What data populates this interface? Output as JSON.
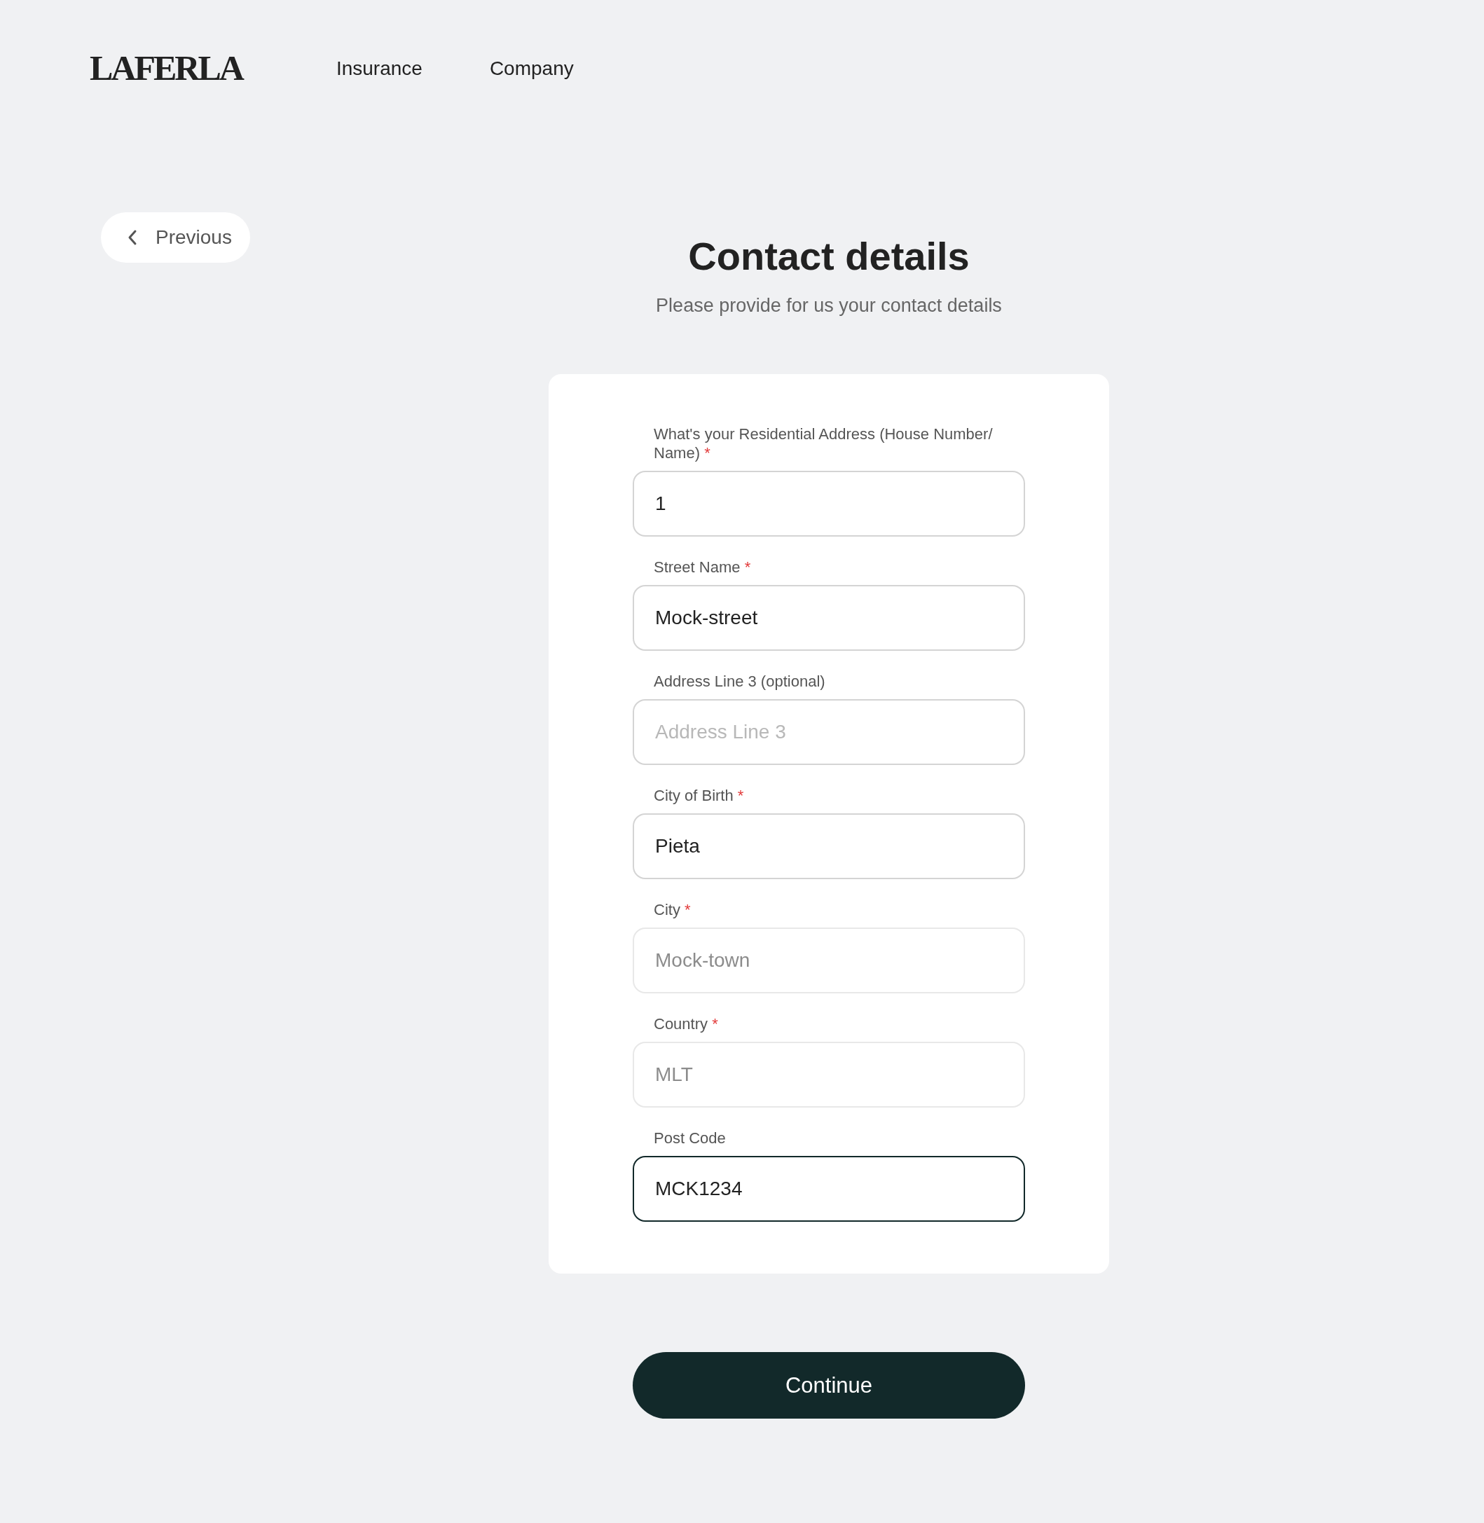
{
  "header": {
    "logo": "LAFERLA",
    "nav": [
      "Insurance",
      "Company"
    ]
  },
  "back_button": {
    "label": "Previous"
  },
  "title": "Contact details",
  "subtitle": "Please provide for us your contact details",
  "form": {
    "fields": [
      {
        "label": "What's your Residential Address (House Number/ Name)",
        "required_mark": "*",
        "value": "1",
        "disabled": false,
        "focused": false
      },
      {
        "label": "Street Name",
        "required_mark": "*",
        "value": "Mock-street",
        "disabled": false,
        "focused": false
      },
      {
        "label": "Address Line 3 (optional)",
        "placeholder": "Address Line 3",
        "disabled": false,
        "focused": false
      },
      {
        "label": "City of Birth",
        "required_mark": "*",
        "value": "Pieta",
        "disabled": false,
        "focused": false
      },
      {
        "label": "City",
        "required_mark": "*",
        "value": "Mock-town",
        "disabled": true,
        "focused": false
      },
      {
        "label": "Country",
        "required_mark": "*",
        "value": "MLT",
        "disabled": true,
        "focused": false
      },
      {
        "label": "Post Code",
        "value": "MCK1234",
        "disabled": false,
        "focused": true
      }
    ]
  },
  "continue_button": {
    "label": "Continue"
  }
}
